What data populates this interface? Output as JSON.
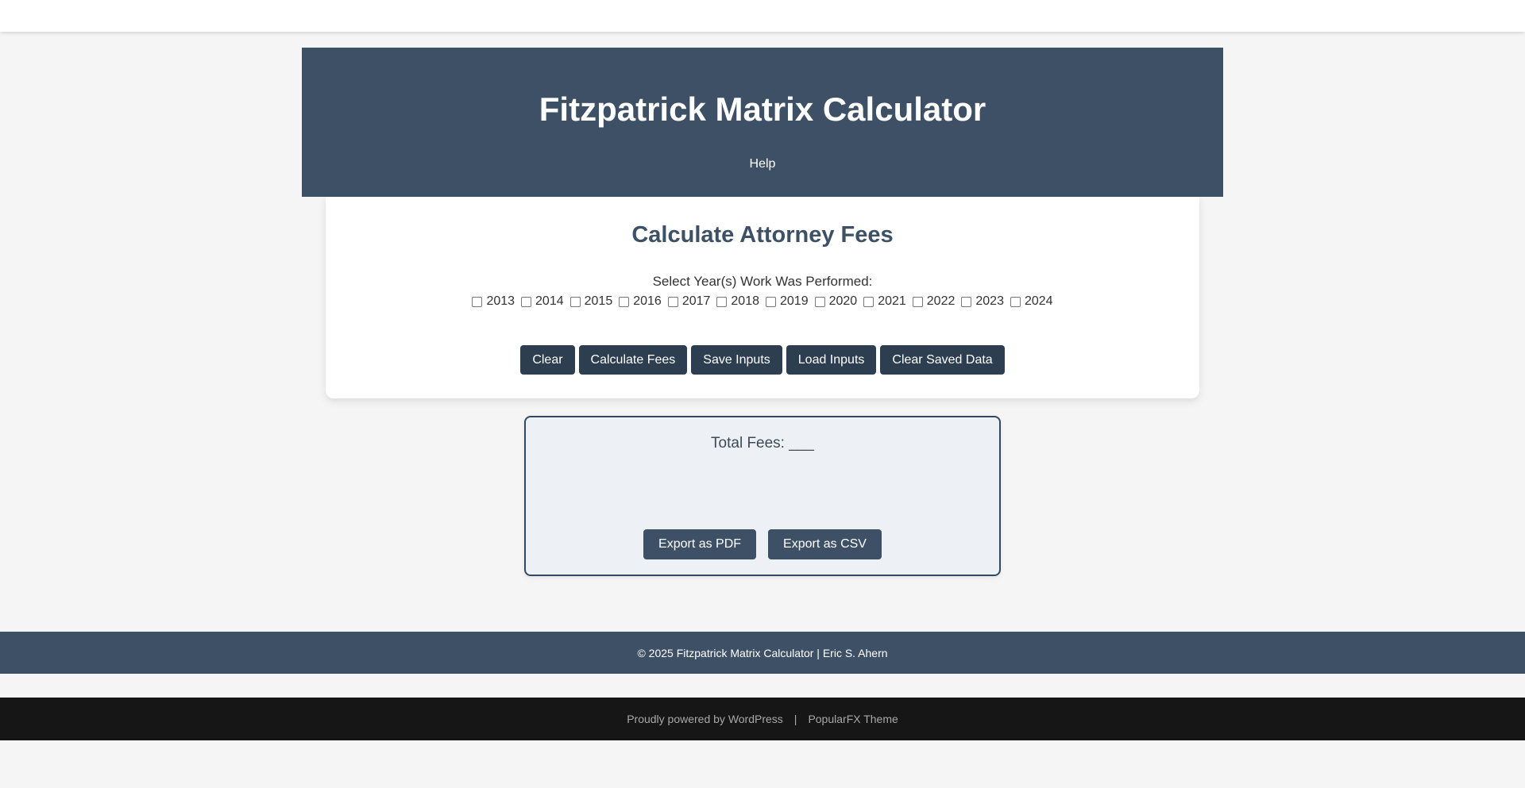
{
  "header": {
    "title": "Fitzpatrick Matrix Calculator",
    "nav": {
      "help_label": "Help"
    }
  },
  "calculator": {
    "title": "Calculate Attorney Fees",
    "years_label": "Select Year(s) Work Was Performed:",
    "years": [
      {
        "label": "2013",
        "checked": false
      },
      {
        "label": "2014",
        "checked": false
      },
      {
        "label": "2015",
        "checked": false
      },
      {
        "label": "2016",
        "checked": false
      },
      {
        "label": "2017",
        "checked": false
      },
      {
        "label": "2018",
        "checked": false
      },
      {
        "label": "2019",
        "checked": false
      },
      {
        "label": "2020",
        "checked": false
      },
      {
        "label": "2021",
        "checked": false
      },
      {
        "label": "2022",
        "checked": false
      },
      {
        "label": "2023",
        "checked": false
      },
      {
        "label": "2024",
        "checked": false
      }
    ],
    "buttons": {
      "clear": "Clear",
      "calculate": "Calculate Fees",
      "save": "Save Inputs",
      "load": "Load Inputs",
      "clear_saved": "Clear Saved Data"
    }
  },
  "results": {
    "total_fees_label": "Total Fees: ___",
    "export_pdf": "Export as PDF",
    "export_csv": "Export as CSV"
  },
  "footer": {
    "copyright": "© 2025 Fitzpatrick Matrix Calculator | Eric S. Ahern"
  },
  "wp_footer": {
    "powered_by": "Proudly powered by WordPress",
    "separator": "|",
    "theme": "PopularFX Theme"
  },
  "colors": {
    "header_bg": "#3d5066",
    "button_bg": "#2c3e50",
    "results_bg": "#edf1f5",
    "wp_footer_bg": "#161616"
  }
}
